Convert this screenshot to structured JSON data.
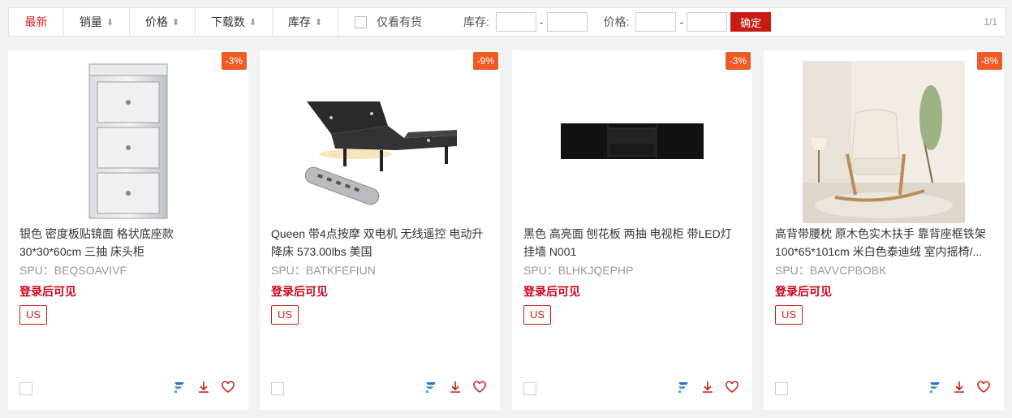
{
  "toolbar": {
    "sorts": [
      {
        "label": "最新",
        "arrow": ""
      },
      {
        "label": "销量",
        "arrow": "⬇"
      },
      {
        "label": "价格",
        "arrow": "⬍"
      },
      {
        "label": "下载数",
        "arrow": "⬇"
      },
      {
        "label": "库存",
        "arrow": "⬍"
      }
    ],
    "in_stock_label": "仅看有货",
    "stock_label": "库存:",
    "price_label": "价格:",
    "dash": "-",
    "confirm_label": "确定",
    "pager": "1/1"
  },
  "colors": {
    "accent": "#c81c13",
    "badge": "#f05a24",
    "login": "#d0021b"
  },
  "products": [
    {
      "discount": "-3%",
      "title": "银色 密度板贴镜面 格状底座款 30*30*60cm 三抽 床头柜",
      "spu": "SPU：BEQSOAVIVF",
      "login_text": "登录后可见",
      "region": "US",
      "image": "mirrored-nightstand"
    },
    {
      "discount": "-9%",
      "title": "Queen 带4点按摩 双电机 无线遥控 电动升降床 573.00lbs 美国",
      "spu": "SPU：BATKFEFIUN",
      "login_text": "登录后可见",
      "region": "US",
      "image": "adjustable-bed-base"
    },
    {
      "discount": "-3%",
      "title": "黑色 高亮面 刨花板 两抽 电视柜 带LED灯 挂墙 N001",
      "spu": "SPU：BLHKJQEPHP",
      "login_text": "登录后可见",
      "region": "US",
      "image": "black-tv-stand"
    },
    {
      "discount": "-8%",
      "title": "高背带腰枕 原木色实木扶手 靠背座框铁架 100*65*101cm 米白色泰迪绒 室内摇椅/...",
      "spu": "SPU：BAVVCPBOBK",
      "login_text": "登录后可见",
      "region": "US",
      "image": "rocking-chair"
    }
  ]
}
